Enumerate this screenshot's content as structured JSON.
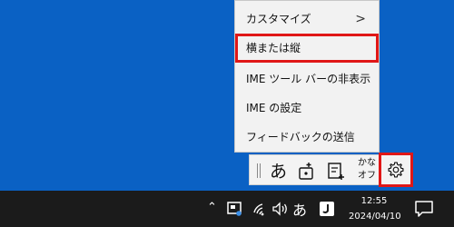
{
  "context_menu": {
    "items": [
      {
        "label": "カスタマイズ",
        "has_submenu": true,
        "submenu_glyph": ">"
      },
      {
        "label": "横または縦",
        "highlighted": true
      },
      {
        "label": "IME ツール バーの非表示"
      },
      {
        "label": "IME の設定"
      },
      {
        "label": "フィードバックの送信"
      }
    ]
  },
  "ime_toolbar": {
    "input_mode": "あ",
    "kana_off_line1": "かな",
    "kana_off_line2": "オフ",
    "settings_icon": "gear-icon"
  },
  "taskbar": {
    "input_mode": "あ",
    "time": "12:55",
    "date": "2024/04/10",
    "colors": {
      "background": "#1b1b1b",
      "desktop": "#0a61c4",
      "highlight": "#e01717"
    }
  }
}
